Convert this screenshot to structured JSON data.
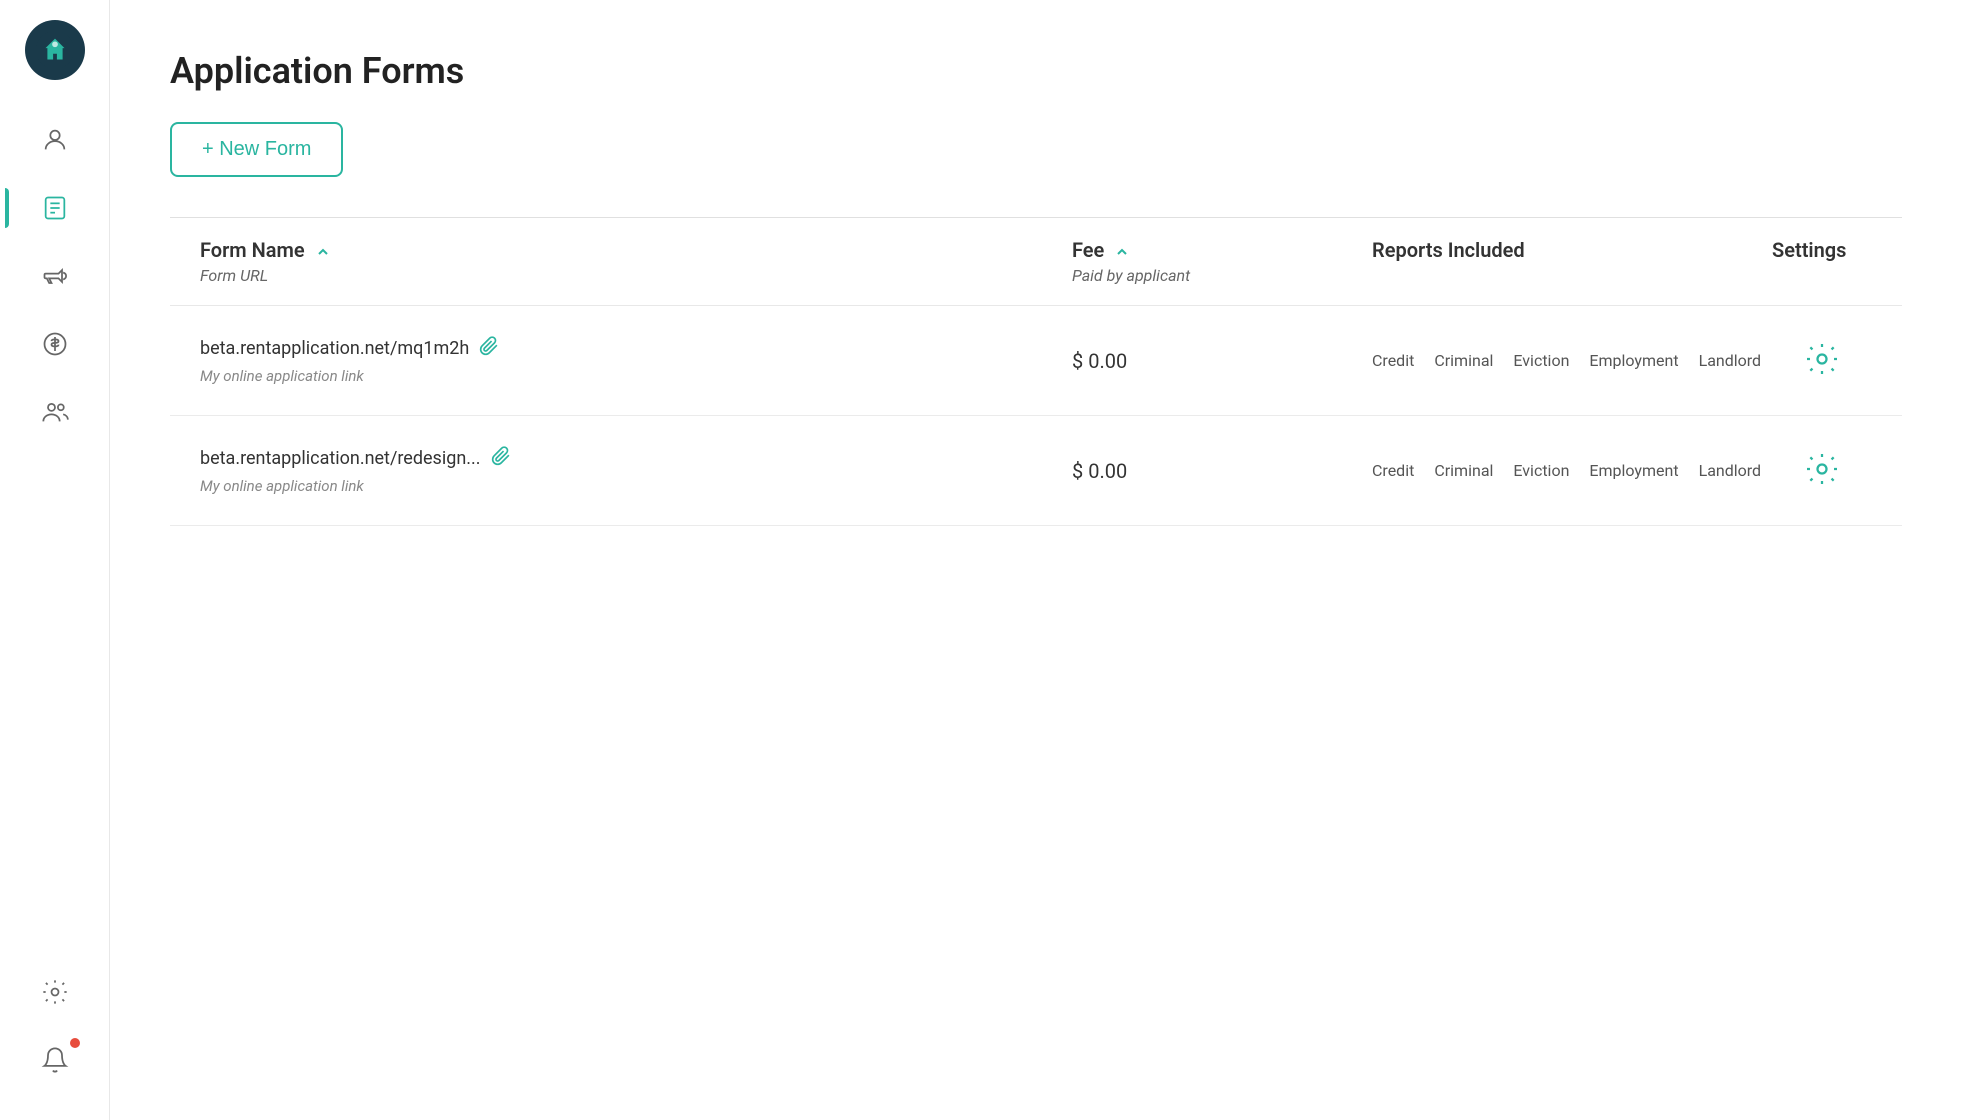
{
  "app": {
    "title": "Application Forms"
  },
  "sidebar": {
    "logo_alt": "Home Logo",
    "items": [
      {
        "id": "person",
        "label": "Person",
        "active": false
      },
      {
        "id": "forms",
        "label": "Forms",
        "active": true
      },
      {
        "id": "megaphone",
        "label": "Marketing",
        "active": false
      },
      {
        "id": "dollar",
        "label": "Payments",
        "active": false
      },
      {
        "id": "team",
        "label": "Team",
        "active": false
      },
      {
        "id": "settings",
        "label": "Settings",
        "active": false
      },
      {
        "id": "bell",
        "label": "Notifications",
        "active": false,
        "has_dot": true
      }
    ]
  },
  "toolbar": {
    "new_form_label": "+ New Form"
  },
  "table": {
    "headers": [
      {
        "id": "form-name",
        "label": "Form Name",
        "sub": "Form URL",
        "sortable": true
      },
      {
        "id": "fee",
        "label": "Fee",
        "sub": "Paid by applicant",
        "sortable": true
      },
      {
        "id": "reports",
        "label": "Reports Included",
        "sortable": false
      },
      {
        "id": "settings-col",
        "label": "Settings",
        "sortable": false
      }
    ],
    "rows": [
      {
        "url": "beta.rentapplication.net/mq1m2h",
        "sub": "My online application link",
        "fee": "$ 0.00",
        "reports": [
          "Credit",
          "Criminal",
          "Eviction",
          "Employment",
          "Landlord"
        ]
      },
      {
        "url": "beta.rentapplication.net/redesign...",
        "sub": "My online application link",
        "fee": "$ 0.00",
        "reports": [
          "Credit",
          "Criminal",
          "Eviction",
          "Employment",
          "Landlord"
        ]
      }
    ]
  }
}
